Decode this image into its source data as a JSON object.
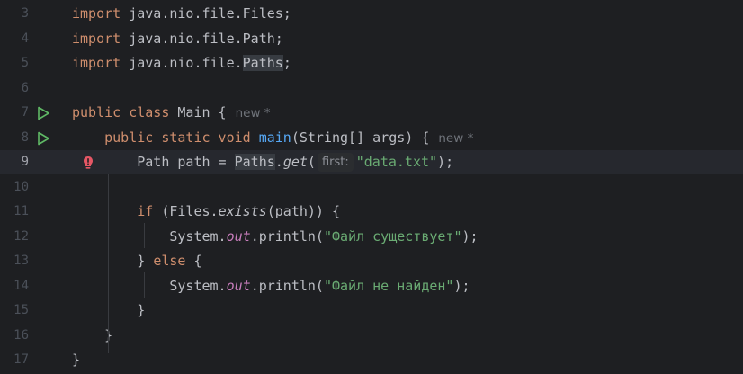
{
  "editor": {
    "lines": [
      {
        "num": "3",
        "code": [
          {
            "t": "import",
            "c": "kw"
          },
          {
            "t": " java.nio.file.Files;"
          }
        ]
      },
      {
        "num": "4",
        "code": [
          {
            "t": "import",
            "c": "kw"
          },
          {
            "t": " java.nio.file.Path;"
          }
        ]
      },
      {
        "num": "5",
        "code": [
          {
            "t": "import",
            "c": "kw"
          },
          {
            "t": " java.nio.file."
          },
          {
            "t": "Paths",
            "c": "hl"
          },
          {
            "t": ";"
          }
        ]
      },
      {
        "num": "6",
        "code": []
      },
      {
        "num": "7",
        "run": true,
        "code": [
          {
            "t": "public class",
            "c": "kw"
          },
          {
            "t": " Main {"
          }
        ],
        "author": "new *"
      },
      {
        "num": "8",
        "run": true,
        "code": [
          {
            "t": "    "
          },
          {
            "t": "public static void",
            "c": "kw"
          },
          {
            "t": " "
          },
          {
            "t": "main",
            "c": "fn"
          },
          {
            "t": "(String[] args) {"
          }
        ],
        "author": "new *"
      },
      {
        "num": "9",
        "error": true,
        "current": true,
        "code": [
          {
            "t": "        Path path = "
          },
          {
            "t": "Paths",
            "c": "hl"
          },
          {
            "t": "."
          },
          {
            "t": "get",
            "c": "it"
          },
          {
            "t": "("
          },
          {
            "hint": "first:"
          },
          {
            "t": "\"data.txt\"",
            "c": "str"
          },
          {
            "t": ");"
          }
        ]
      },
      {
        "num": "10",
        "code": []
      },
      {
        "num": "11",
        "code": [
          {
            "t": "        "
          },
          {
            "t": "if",
            "c": "kw"
          },
          {
            "t": " (Files."
          },
          {
            "t": "exists",
            "c": "it"
          },
          {
            "t": "(path)) {"
          }
        ]
      },
      {
        "num": "12",
        "code": [
          {
            "t": "            System."
          },
          {
            "t": "out",
            "c": "field"
          },
          {
            "t": ".println("
          },
          {
            "t": "\"Файл существует\"",
            "c": "str"
          },
          {
            "t": ");"
          }
        ]
      },
      {
        "num": "13",
        "code": [
          {
            "t": "        } "
          },
          {
            "t": "else",
            "c": "kw"
          },
          {
            "t": " {"
          }
        ]
      },
      {
        "num": "14",
        "code": [
          {
            "t": "            System."
          },
          {
            "t": "out",
            "c": "field"
          },
          {
            "t": ".println("
          },
          {
            "t": "\"Файл не найден\"",
            "c": "str"
          },
          {
            "t": ");"
          }
        ]
      },
      {
        "num": "15",
        "code": [
          {
            "t": "        }"
          }
        ]
      },
      {
        "num": "16",
        "code": [
          {
            "t": "    }"
          }
        ]
      },
      {
        "num": "17",
        "code": [
          {
            "t": "}"
          }
        ]
      }
    ]
  },
  "colors": {
    "background": "#1e1f22",
    "keyword": "#cf8e6d",
    "method": "#56a8f5",
    "string": "#6aab73",
    "field": "#c77dbb",
    "run_icon": "#5fb865",
    "error_icon": "#e55765"
  },
  "icons": {
    "run": "run-gutter-icon",
    "error": "error-bulb-icon"
  }
}
